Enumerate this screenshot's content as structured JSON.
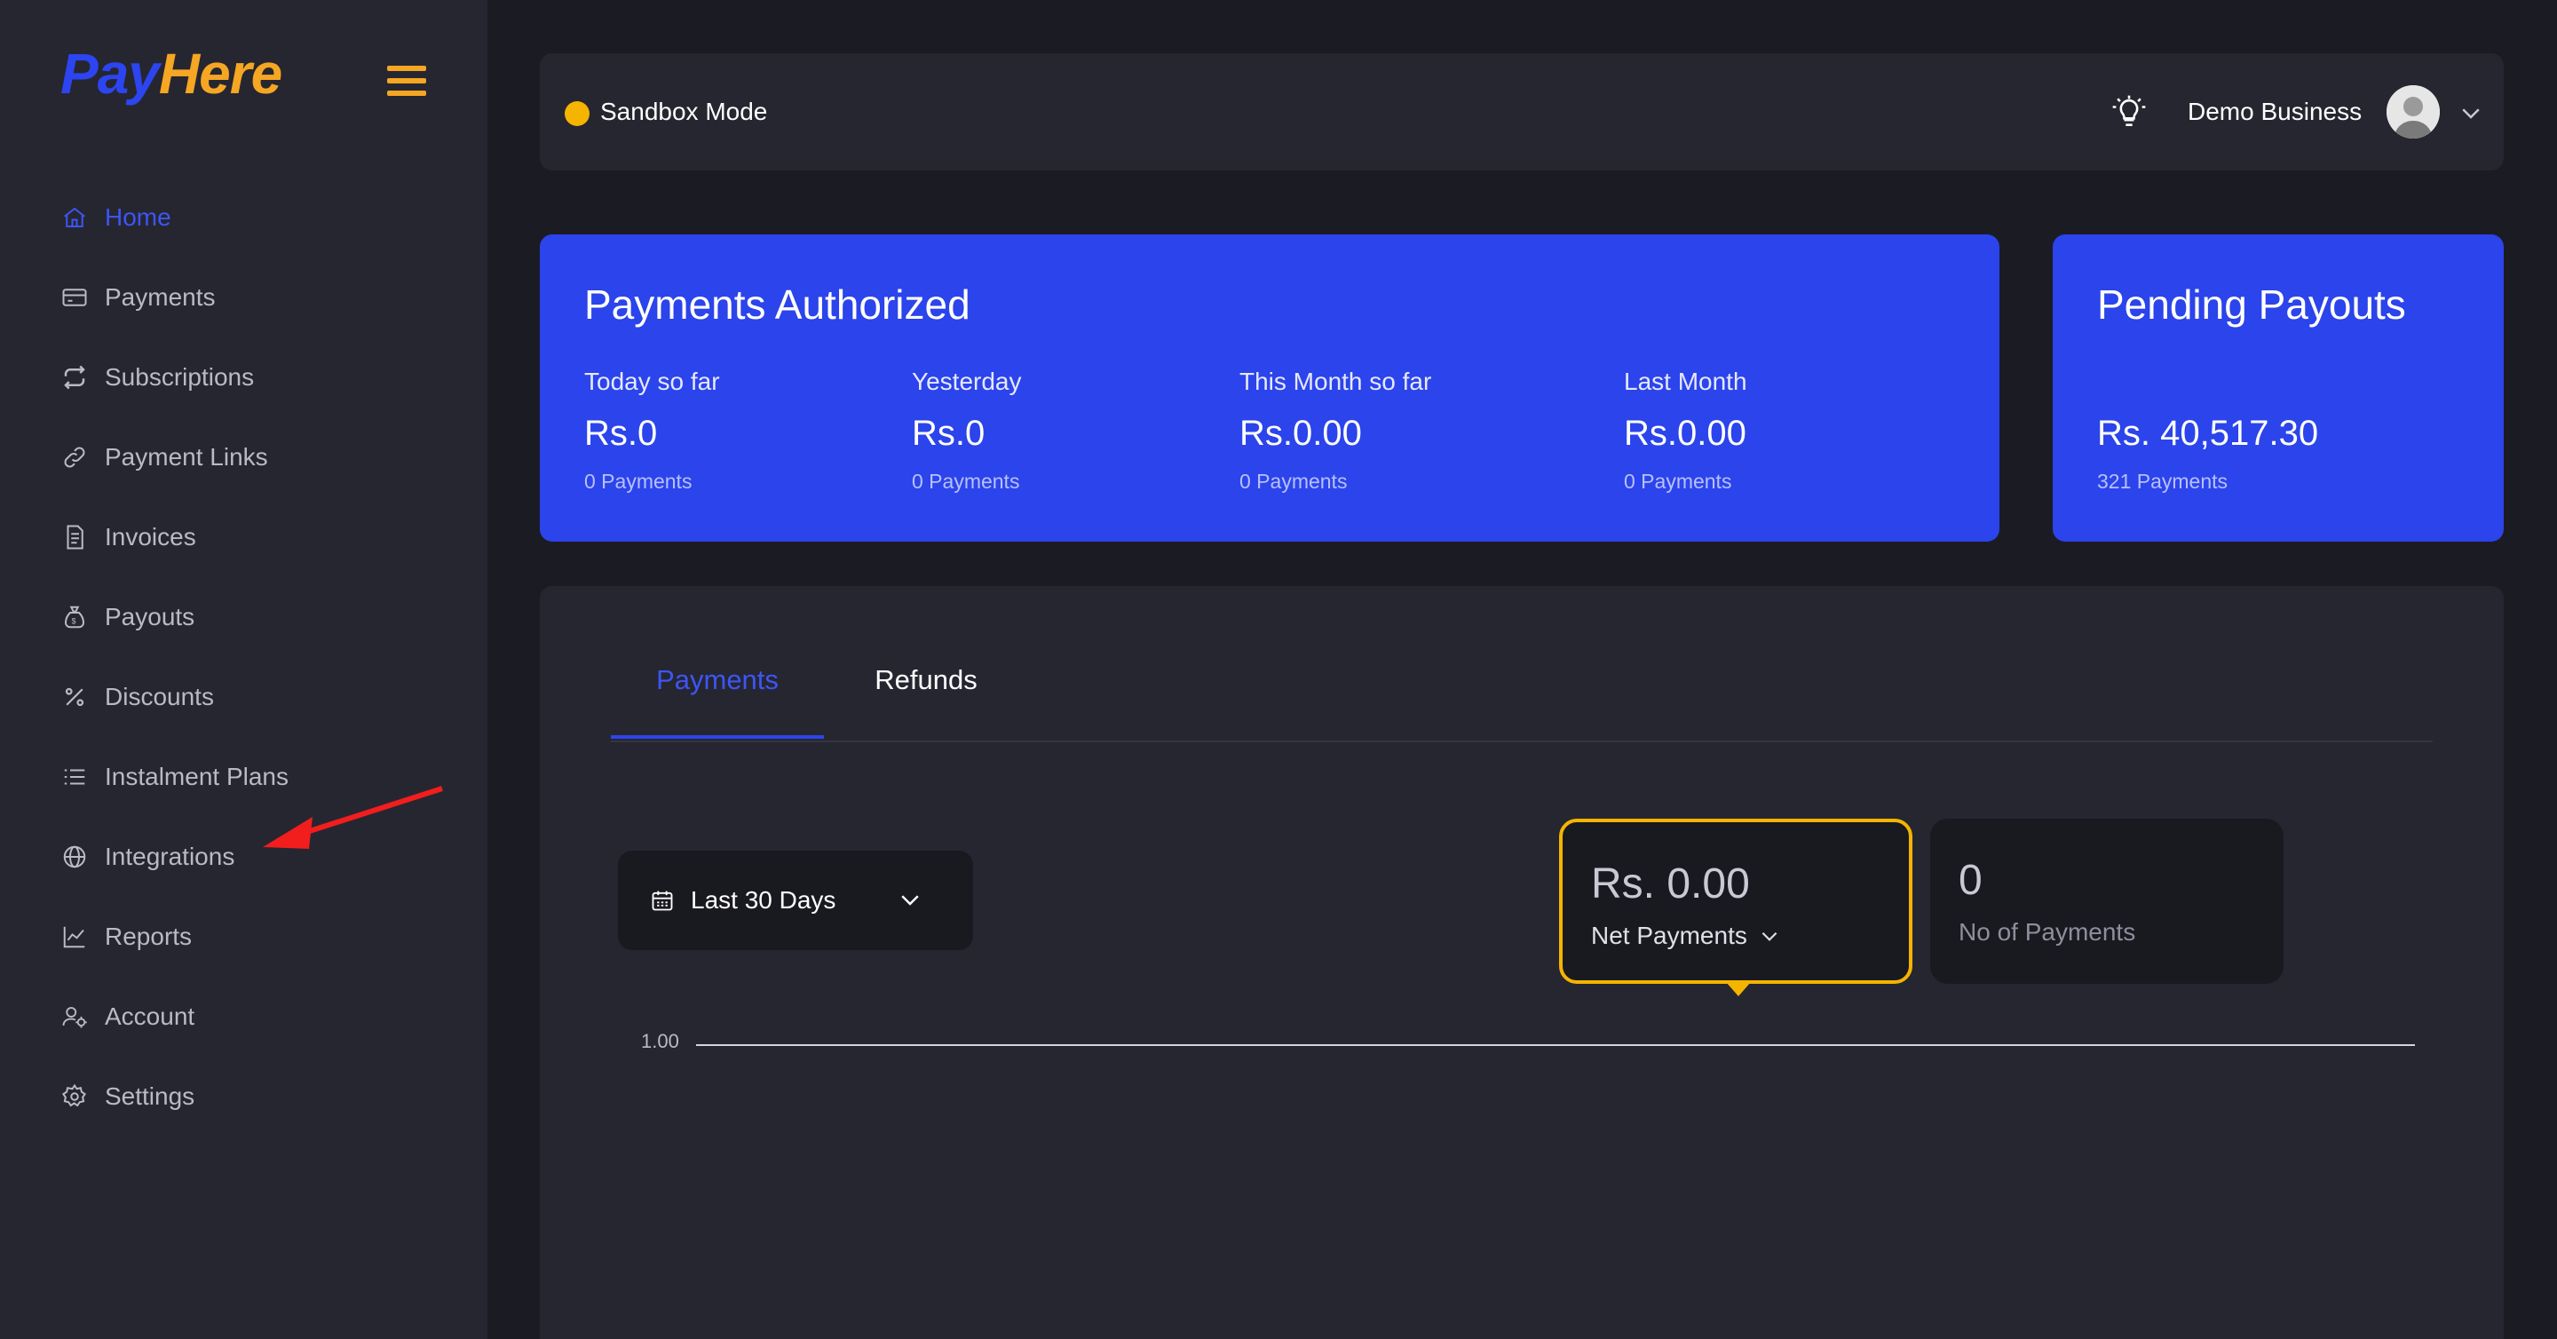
{
  "brand": {
    "part1": "Pay",
    "part2": "Here"
  },
  "sidebar": {
    "items": [
      {
        "label": "Home",
        "icon": "home-icon",
        "active": true
      },
      {
        "label": "Payments",
        "icon": "card-icon"
      },
      {
        "label": "Subscriptions",
        "icon": "repeat-icon"
      },
      {
        "label": "Payment Links",
        "icon": "link-icon"
      },
      {
        "label": "Invoices",
        "icon": "invoice-icon"
      },
      {
        "label": "Payouts",
        "icon": "money-bag-icon"
      },
      {
        "label": "Discounts",
        "icon": "percent-icon"
      },
      {
        "label": "Instalment Plans",
        "icon": "list-icon"
      },
      {
        "label": "Integrations",
        "icon": "globe-icon"
      },
      {
        "label": "Reports",
        "icon": "chart-icon"
      },
      {
        "label": "Account",
        "icon": "users-gear-icon"
      },
      {
        "label": "Settings",
        "icon": "gear-icon"
      }
    ]
  },
  "topbar": {
    "mode_label": "Sandbox Mode",
    "business_name": "Demo Business"
  },
  "authorized": {
    "title": "Payments Authorized",
    "metrics": [
      {
        "label": "Today so far",
        "value": "Rs.0",
        "sub": "0 Payments"
      },
      {
        "label": "Yesterday",
        "value": "Rs.0",
        "sub": "0 Payments"
      },
      {
        "label": "This Month so far",
        "value": "Rs.0.00",
        "sub": "0 Payments"
      },
      {
        "label": "Last Month",
        "value": "Rs.0.00",
        "sub": "0 Payments"
      }
    ]
  },
  "pending": {
    "title": "Pending Payouts",
    "value": "Rs. 40,517.30",
    "sub": "321 Payments"
  },
  "tabs": {
    "payments": "Payments",
    "refunds": "Refunds"
  },
  "range": {
    "label": "Last 30 Days"
  },
  "stats": {
    "net_value": "Rs. 0.00",
    "net_label": "Net Payments",
    "count_value": "0",
    "count_label": "No of Payments"
  },
  "chart_data": {
    "type": "line",
    "yticks": [
      "1.00"
    ],
    "series": []
  },
  "colors": {
    "accent": "#2b44eb",
    "highlight": "#f5b400",
    "background": "#1b1b24",
    "panel": "#262631"
  }
}
